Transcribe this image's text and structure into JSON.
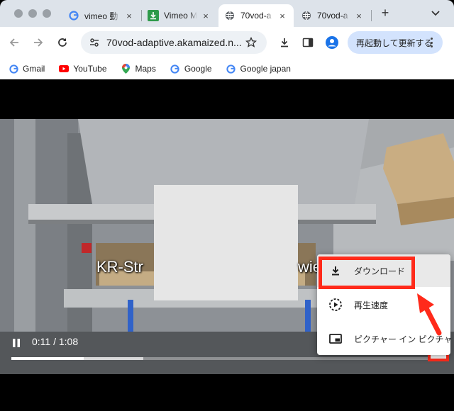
{
  "tabs": [
    {
      "title": "vimeo 動",
      "favicon": "google-icon",
      "active": false
    },
    {
      "title": "Vimeo M",
      "favicon": "download-favicon-icon",
      "active": false
    },
    {
      "title": "70vod-a",
      "favicon": "globe-icon",
      "active": true
    },
    {
      "title": "70vod-a",
      "favicon": "globe-icon",
      "active": false
    }
  ],
  "tab_close_label": "×",
  "new_tab_label": "+",
  "omnibox": {
    "url": "70vod-adaptive.akamaized.n..."
  },
  "relaunch_label": "再起動して更新する",
  "bookmarks": [
    {
      "label": "Gmail",
      "icon": "gmail-icon"
    },
    {
      "label": "YouTube",
      "icon": "youtube-icon"
    },
    {
      "label": "Maps",
      "icon": "maps-icon"
    },
    {
      "label": "Google",
      "icon": "google-icon"
    },
    {
      "label": "Google japan",
      "icon": "google-icon"
    }
  ],
  "video": {
    "subtitle": "KR-Str",
    "subtitle_tail": "wie",
    "time": "0:11 / 1:08",
    "progress_played_fraction": 0.168,
    "progress_buffered_fraction": 0.305
  },
  "menu": {
    "items": [
      {
        "label": "ダウンロード",
        "icon": "download-icon"
      },
      {
        "label": "再生速度",
        "icon": "playback-speed-icon"
      },
      {
        "label": "ピクチャー イン ピクチャー",
        "icon": "picture-in-picture-icon"
      }
    ]
  },
  "colors": {
    "annotation_red": "#ff2a1a",
    "tab_strip": "#dde3ea",
    "relaunch_bg": "#d3e3fd"
  }
}
